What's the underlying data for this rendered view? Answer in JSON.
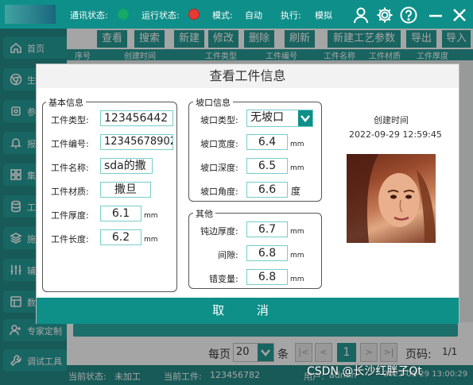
{
  "topbar": {
    "comm_label": "通讯状态:",
    "run_label": "运行状态:",
    "mode_label": "模式:",
    "mode_value": "自动",
    "exec_label": "执行:",
    "exec_value": "模拟",
    "comm_color": "#1aa86a",
    "run_color": "#e53935"
  },
  "sidebar": {
    "items": [
      {
        "label": "首页",
        "icon": "home-icon"
      },
      {
        "label": "生产",
        "icon": "chrome-icon"
      },
      {
        "label": "参",
        "icon": "settings-icon"
      },
      {
        "label": "报",
        "icon": "bell-icon"
      },
      {
        "label": "集",
        "icon": "grid-icon"
      },
      {
        "label": "工",
        "icon": "database-icon"
      },
      {
        "label": "施",
        "icon": "layers-icon"
      },
      {
        "label": "辅",
        "icon": "sliders-icon"
      },
      {
        "label": "数",
        "icon": "layout-icon"
      },
      {
        "label": "专家定制",
        "icon": "user-plus-icon"
      },
      {
        "label": "调试工具",
        "icon": "wrench-icon"
      }
    ]
  },
  "toolbar": {
    "view": "查看",
    "search": "搜索",
    "new": "新建",
    "edit": "修改",
    "delete": "删除",
    "refresh": "刷新",
    "new_param": "新建工艺参数",
    "export": "导出",
    "import": "导入"
  },
  "table": {
    "headers": [
      "序号",
      "创建时间",
      "工件类型",
      "工件编号",
      "工件名称",
      "工件材质",
      "工件厚度"
    ]
  },
  "pagination": {
    "per_page_label": "每页",
    "per_page_value": "20",
    "unit": "条",
    "first": "|<",
    "prev": "<",
    "current": "1",
    "next": ">",
    "last": ">|",
    "page_label": "页码:",
    "page_value": "1/1"
  },
  "statusbar": {
    "state_label": "当前状态:",
    "state_value": "未加工",
    "work_label": "当前工件:",
    "work_value": "123456782",
    "user_label": "用户:",
    "user_value": "admin",
    "time_value": "2022-09-29 13:00:29"
  },
  "watermark": "CSDN @长沙红胖子Qt",
  "dialog": {
    "title": "查看工件信息",
    "basic": {
      "legend": "基本信息",
      "type_label": "工件类型:",
      "type_value": "123456442",
      "id_label": "工件编号:",
      "id_value": "12345678902",
      "name_label": "工件名称:",
      "name_value": "sda的撒",
      "material_label": "工件材质:",
      "material_value": "撒旦",
      "thickness_label": "工件厚度:",
      "thickness_value": "6.1",
      "thickness_unit": "mm",
      "length_label": "工件长度:",
      "length_value": "6.2",
      "length_unit": "mm"
    },
    "groove": {
      "legend": "坡口信息",
      "type_label": "坡口类型:",
      "type_value": "无坡口",
      "width_label": "坡口宽度:",
      "width_value": "6.4",
      "width_unit": "mm",
      "depth_label": "坡口深度:",
      "depth_value": "6.5",
      "depth_unit": "mm",
      "angle_label": "坡口角度:",
      "angle_value": "6.6",
      "angle_unit": "度"
    },
    "other": {
      "legend": "其他",
      "blunt_label": "钝边厚度:",
      "blunt_value": "6.7",
      "blunt_unit": "mm",
      "gap_label": "间隙:",
      "gap_value": "6.8",
      "gap_unit": "mm",
      "misalign_label": "错变量:",
      "misalign_value": "6.8",
      "misalign_unit": "mm"
    },
    "created_label": "创建时间",
    "created_value": "2022-09-29 12:59:45",
    "cancel": "取 消"
  }
}
